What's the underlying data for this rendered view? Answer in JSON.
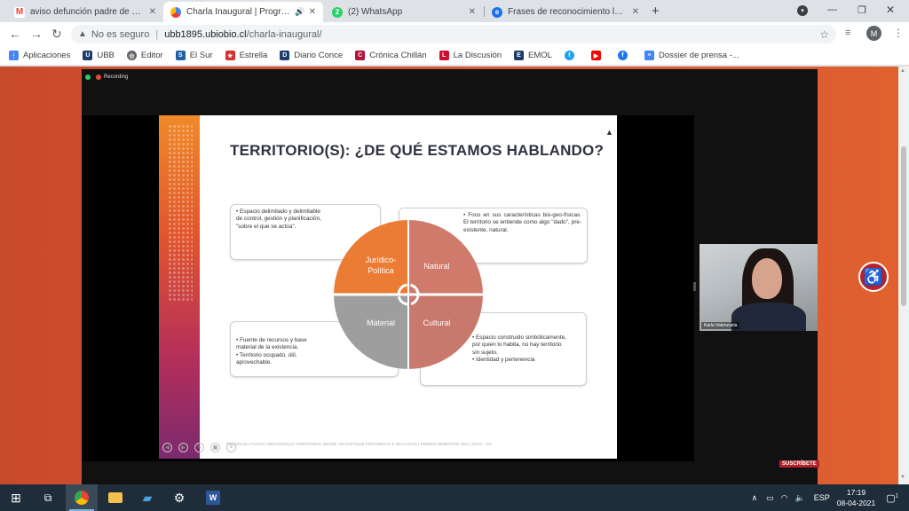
{
  "browser": {
    "tabs": [
      {
        "label": "aviso defunción padre de Víctor P",
        "favicon": "gmail-icon",
        "color": "#ea4335",
        "active": false
      },
      {
        "label": "Charla Inaugural | Programa",
        "favicon": "chrome-site-icon",
        "color": "#4285f4",
        "active": true,
        "audio": true
      },
      {
        "label": "(2) WhatsApp",
        "favicon": "whatsapp-icon",
        "color": "#25d366",
        "active": false
      },
      {
        "label": "Frases de reconocimiento laboral",
        "favicon": "edge-icon",
        "color": "#1a73e8",
        "active": false
      }
    ],
    "new_tab": "+",
    "address": {
      "security_text": "No es seguro",
      "separator": "|",
      "host": "ubb1895.ubiobio.cl",
      "path": "/charla-inaugural/"
    },
    "profile_initial": "M"
  },
  "bookmarks": [
    {
      "label": "Aplicaciones",
      "color": "#4285f4"
    },
    {
      "label": "UBB",
      "color": "#1d3b6b"
    },
    {
      "label": "Editor",
      "color": "#5f6368"
    },
    {
      "label": "El Sur",
      "color": "#1e5fa8"
    },
    {
      "label": "Estrella",
      "color": "#d62f2f"
    },
    {
      "label": "Diario Conce",
      "color": "#1b3c6e"
    },
    {
      "label": "Crónica Chillán",
      "color": "#b0123a"
    },
    {
      "label": "La Discusión",
      "color": "#c8102e"
    },
    {
      "label": "EMOL",
      "color": "#1d3b6b"
    },
    {
      "label": "",
      "color": "#1da1f2",
      "icon": "twitter-icon"
    },
    {
      "label": "",
      "color": "#ff0000",
      "icon": "youtube-icon"
    },
    {
      "label": "",
      "color": "#1877f2",
      "icon": "facebook-icon"
    },
    {
      "label": "Dossier de prensa -...",
      "color": "#4285f4"
    }
  ],
  "zoom": {
    "recording_label": "Recording",
    "participant_name": "Karla Valenzuela"
  },
  "slide": {
    "title": "TERRITORIO(S): ¿DE QUÉ ESTAMOS HABLANDO?",
    "boxes": {
      "top_left": [
        "Espacio delimitado y delimitable de control, gestión y planificación, \"sobre el que se actúa\"."
      ],
      "top_right": [
        "Foco en sus características bio-geo-físicas. El territorio se entiende como algo \"dado\", pre-existente, natural."
      ],
      "bottom_left": [
        "Fuente de recursos y base material de la existencia.",
        "Territorio ocupado, útil, aprovechable."
      ],
      "bottom_right": [
        "Espacio construido simbólicamente, por quien lo habita, no hay territorio sin sujeto.",
        "Identidad y pertenencia"
      ]
    },
    "quadrants": {
      "tl": {
        "label_line1": "Jurídico-",
        "label_line2": "Política",
        "color": "#ec7b33"
      },
      "tr": {
        "label": "Natural",
        "color": "#cf7a6a"
      },
      "bl": {
        "label": "Material",
        "color": "#9e9e9e"
      },
      "br": {
        "label": "Cultural",
        "color": "#c8796b"
      }
    },
    "footer": "PROGRAMA PILOTO: DESARROLLO TERRITORIAL DESDE UN ENFOQUE PERTINENTE E INCLUSIVO   |   PRIMER SEMESTRE 2021   |   DGAI - UFI"
  },
  "page": {
    "subscribe_label": "SUSCRÍBETE"
  },
  "taskbar": {
    "language": "ESP",
    "time": "17:19",
    "date": "08-04-2021",
    "notifications": "1"
  }
}
